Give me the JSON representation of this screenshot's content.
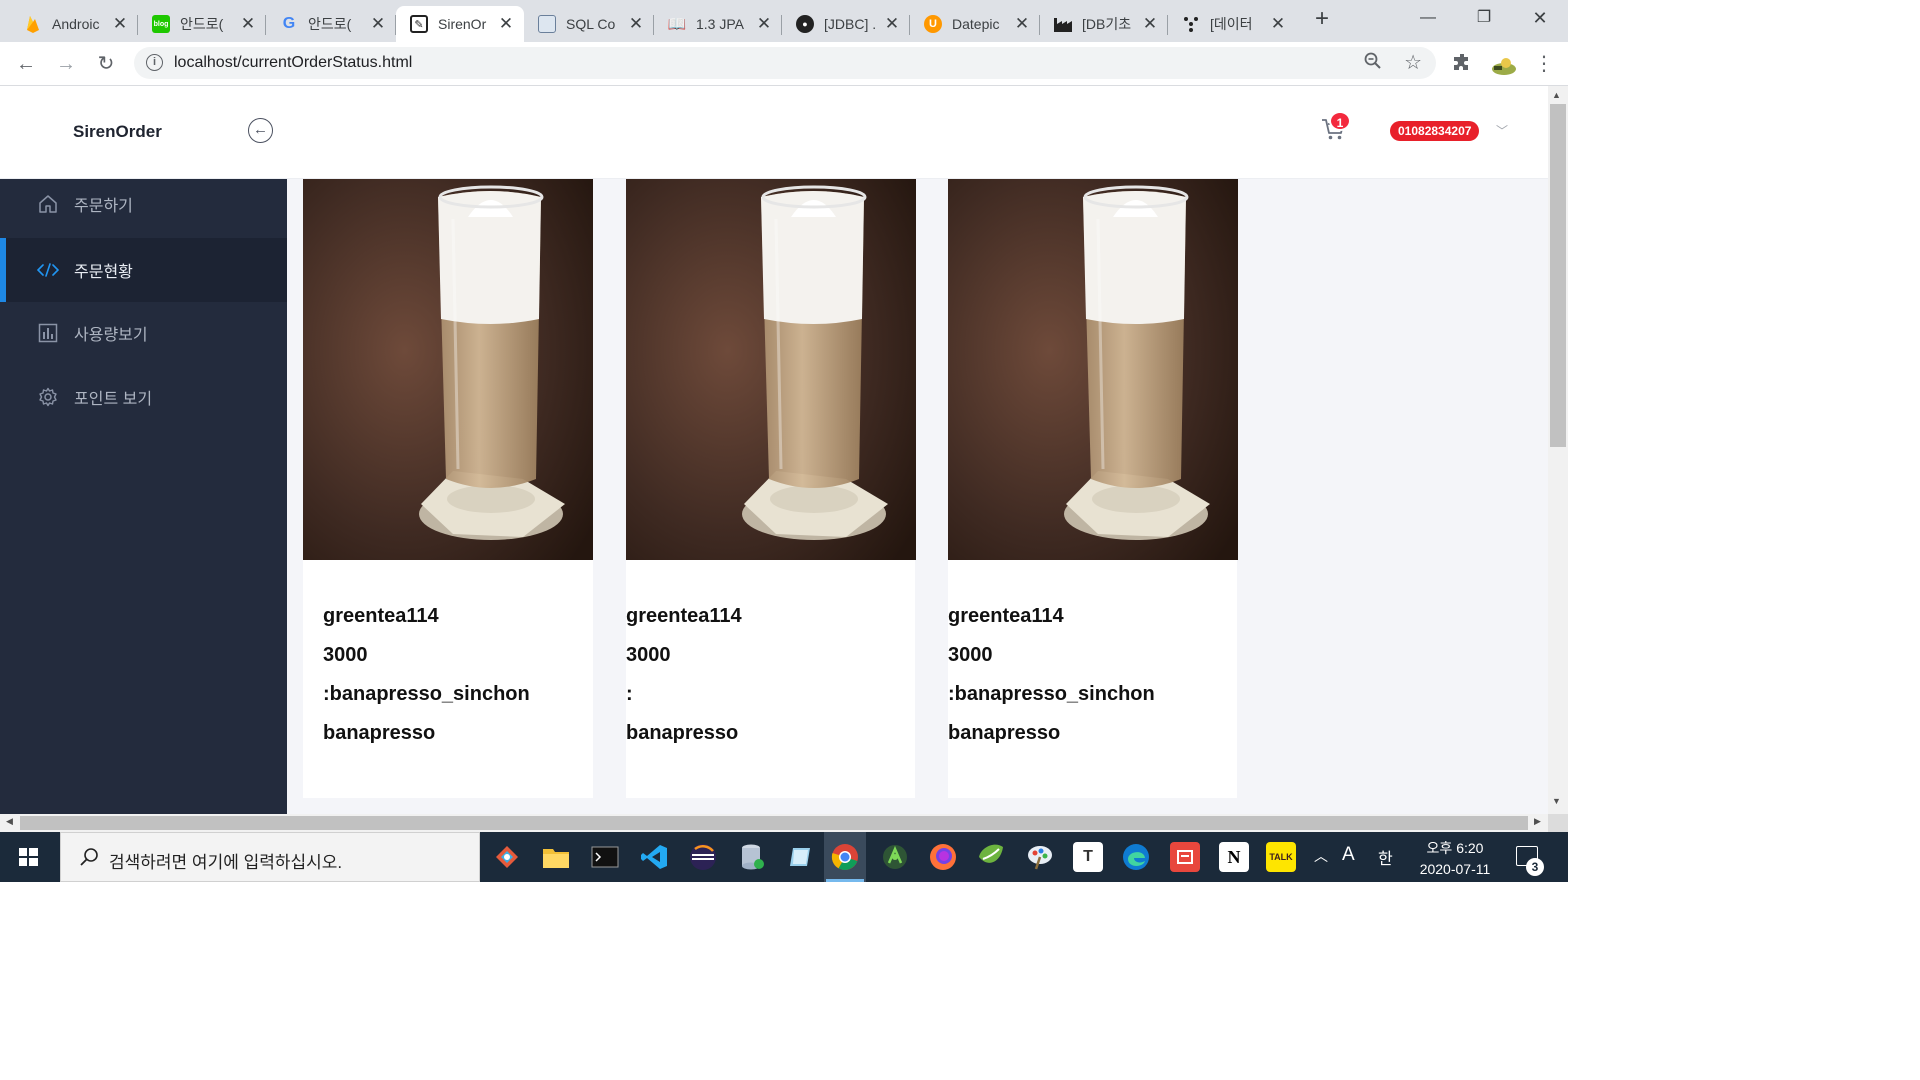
{
  "browser": {
    "tabs": [
      {
        "label": "Androic",
        "icon": "firebase-icon"
      },
      {
        "label": "안드로(",
        "icon": "naver-blog-icon"
      },
      {
        "label": "안드로(",
        "icon": "google-icon"
      },
      {
        "label": "SirenOr",
        "icon": "sirenorder-icon"
      },
      {
        "label": "SQL Co",
        "icon": "window-icon"
      },
      {
        "label": "1.3 JPA",
        "icon": "book-icon"
      },
      {
        "label": "[JDBC] .",
        "icon": "github-icon"
      },
      {
        "label": "Datepic",
        "icon": "ui-icon"
      },
      {
        "label": "[DB기초",
        "icon": "factory-icon"
      },
      {
        "label": "[데이터",
        "icon": "dots-icon"
      }
    ],
    "url": "localhost/currentOrderStatus.html"
  },
  "app": {
    "brand": "SirenOrder",
    "cart_count": "1",
    "user_phone": "01082834207"
  },
  "sidebar": {
    "items": [
      {
        "label": "주문하기",
        "icon": "home-icon",
        "active": false
      },
      {
        "label": "주문현황",
        "icon": "code-icon",
        "active": true
      },
      {
        "label": "사용량보기",
        "icon": "bar-chart-icon",
        "active": false
      },
      {
        "label": "포인트 보기",
        "icon": "gear-icon",
        "active": false
      }
    ]
  },
  "orders": [
    {
      "name": "greentea114",
      "price": "3000",
      "store": ":banapresso_sinchon",
      "brand": "banapresso"
    },
    {
      "name": "greentea114",
      "price": "3000",
      "store": ":",
      "brand": "banapresso"
    },
    {
      "name": "greentea114",
      "price": "3000",
      "store": ":banapresso_sinchon",
      "brand": "banapresso"
    }
  ],
  "taskbar": {
    "search_placeholder": "검색하려면 여기에 입력하십시오.",
    "ime_lang": "A",
    "ime_mode": "한",
    "time": "오후 6:20",
    "date": "2020-07-11",
    "notification_count": "3"
  }
}
